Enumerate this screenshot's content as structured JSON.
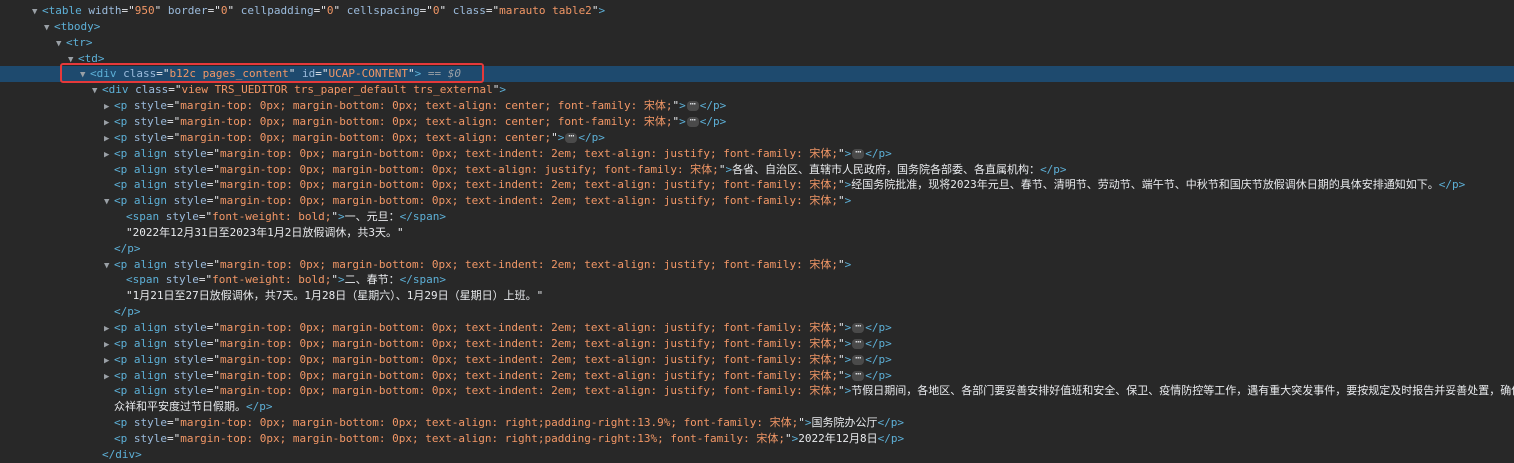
{
  "nodes": [
    {
      "indent": 0,
      "arrow": "expanded",
      "open": "<table",
      "attrs": [
        [
          "width",
          "950"
        ],
        [
          "border",
          "0"
        ],
        [
          "cellpadding",
          "0"
        ],
        [
          "cellspacing",
          "0"
        ],
        [
          "class",
          "marauto table2"
        ]
      ],
      "close": ">"
    },
    {
      "indent": 1,
      "arrow": "expanded",
      "open": "<tbody",
      "attrs": [],
      "close": ">"
    },
    {
      "indent": 2,
      "arrow": "expanded",
      "open": "<tr",
      "attrs": [],
      "close": ">"
    },
    {
      "indent": 3,
      "arrow": "expanded",
      "open": "<td",
      "attrs": [],
      "close": ">"
    },
    {
      "indent": 4,
      "arrow": "expanded",
      "open": "<div",
      "attrs": [
        [
          "class",
          "b12c pages_content"
        ],
        [
          "id",
          "UCAP-CONTENT"
        ]
      ],
      "close": ">",
      "suffix": " == $0",
      "selected": true
    },
    {
      "indent": 5,
      "arrow": "expanded",
      "open": "<div",
      "attrs": [
        [
          "class",
          "view TRS_UEDITOR trs_paper_default trs_external"
        ]
      ],
      "close": ">"
    },
    {
      "indent": 6,
      "arrow": "collapsed",
      "open": "<p",
      "attrs": [
        [
          "style",
          "margin-top: 0px; margin-bottom: 0px; text-align: center; font-family: 宋体;"
        ]
      ],
      "close": ">",
      "ellipsis": true,
      "end": "</p>"
    },
    {
      "indent": 6,
      "arrow": "collapsed",
      "open": "<p",
      "attrs": [
        [
          "style",
          "margin-top: 0px; margin-bottom: 0px; text-align: center; font-family: 宋体;"
        ]
      ],
      "close": ">",
      "ellipsis": true,
      "end": "</p>"
    },
    {
      "indent": 6,
      "arrow": "collapsed",
      "open": "<p",
      "attrs": [
        [
          "style",
          "margin-top: 0px; margin-bottom: 0px; text-align: center;"
        ]
      ],
      "close": ">",
      "ellipsis": true,
      "end": "</p>"
    },
    {
      "indent": 6,
      "arrow": "collapsed",
      "open": "<p align",
      "attrs": [
        [
          "style",
          "margin-top: 0px; margin-bottom: 0px; text-indent: 2em; text-align: justify; font-family: 宋体;"
        ]
      ],
      "close": ">",
      "ellipsis": true,
      "end": "</p>"
    },
    {
      "indent": 6,
      "arrow": "none",
      "open": "<p align",
      "attrs": [
        [
          "style",
          "margin-top: 0px; margin-bottom: 0px; text-align: justify; font-family: 宋体;"
        ]
      ],
      "close": ">",
      "text": "各省、自治区、直辖市人民政府，国务院各部委、各直属机构：",
      "end": "</p>"
    },
    {
      "indent": 6,
      "arrow": "none",
      "open": "<p align",
      "attrs": [
        [
          "style",
          "margin-top: 0px; margin-bottom: 0px; text-indent: 2em; text-align: justify; font-family: 宋体;"
        ]
      ],
      "close": ">",
      "text": "经国务院批准，现将2023年元旦、春节、清明节、劳动节、端午节、中秋节和国庆节放假调休日期的具体安排通知如下。",
      "end": "</p>"
    },
    {
      "indent": 6,
      "arrow": "expanded",
      "open": "<p align",
      "attrs": [
        [
          "style",
          "margin-top: 0px; margin-bottom: 0px; text-indent: 2em; text-align: justify; font-family: 宋体;"
        ]
      ],
      "close": ">"
    },
    {
      "indent": 7,
      "arrow": "none",
      "open": "<span",
      "attrs": [
        [
          "style",
          "font-weight: bold;"
        ]
      ],
      "close": ">",
      "text": "一、元旦：",
      "end": "</span>"
    },
    {
      "indent": 7,
      "arrow": "none",
      "plain": "\"2022年12月31日至2023年1月2日放假调休，共3天。\""
    },
    {
      "indent": 6,
      "arrow": "none",
      "endonly": "</p>"
    },
    {
      "indent": 6,
      "arrow": "expanded",
      "open": "<p align",
      "attrs": [
        [
          "style",
          "margin-top: 0px; margin-bottom: 0px; text-indent: 2em; text-align: justify; font-family: 宋体;"
        ]
      ],
      "close": ">"
    },
    {
      "indent": 7,
      "arrow": "none",
      "open": "<span",
      "attrs": [
        [
          "style",
          "font-weight: bold;"
        ]
      ],
      "close": ">",
      "text": "二、春节：",
      "end": "</span>"
    },
    {
      "indent": 7,
      "arrow": "none",
      "plain": "\"1月21日至27日放假调休，共7天。1月28日（星期六）、1月29日（星期日）上班。\""
    },
    {
      "indent": 6,
      "arrow": "none",
      "endonly": "</p>"
    },
    {
      "indent": 6,
      "arrow": "collapsed",
      "open": "<p align",
      "attrs": [
        [
          "style",
          "margin-top: 0px; margin-bottom: 0px; text-indent: 2em; text-align: justify; font-family: 宋体;"
        ]
      ],
      "close": ">",
      "ellipsis": true,
      "end": "</p>"
    },
    {
      "indent": 6,
      "arrow": "collapsed",
      "open": "<p align",
      "attrs": [
        [
          "style",
          "margin-top: 0px; margin-bottom: 0px; text-indent: 2em; text-align: justify; font-family: 宋体;"
        ]
      ],
      "close": ">",
      "ellipsis": true,
      "end": "</p>"
    },
    {
      "indent": 6,
      "arrow": "collapsed",
      "open": "<p align",
      "attrs": [
        [
          "style",
          "margin-top: 0px; margin-bottom: 0px; text-indent: 2em; text-align: justify; font-family: 宋体;"
        ]
      ],
      "close": ">",
      "ellipsis": true,
      "end": "</p>"
    },
    {
      "indent": 6,
      "arrow": "collapsed",
      "open": "<p align",
      "attrs": [
        [
          "style",
          "margin-top: 0px; margin-bottom: 0px; text-indent: 2em; text-align: justify; font-family: 宋体;"
        ]
      ],
      "close": ">",
      "ellipsis": true,
      "end": "</p>"
    },
    {
      "indent": 6,
      "arrow": "none",
      "open": "<p align",
      "attrs": [
        [
          "style",
          "margin-top: 0px; margin-bottom: 0px; text-indent: 2em; text-align: justify; font-family: 宋体;"
        ]
      ],
      "close": ">",
      "text": "节假日期间，各地区、各部门要妥善安排好值班和安全、保卫、疫情防控等工作，遇有重大突发事件，要按规定及时报告并妥善处置，确保"
    },
    {
      "indent": 6,
      "arrow": "none",
      "plain": "众祥和平安度过节日假期。",
      "end": "</p>"
    },
    {
      "indent": 6,
      "arrow": "none",
      "open": "<p",
      "attrs": [
        [
          "style",
          "margin-top: 0px; margin-bottom: 0px; text-align: right;padding-right:13.9%; font-family: 宋体;"
        ]
      ],
      "close": ">",
      "text": "国务院办公厅",
      "end": "</p>"
    },
    {
      "indent": 6,
      "arrow": "none",
      "open": "<p",
      "attrs": [
        [
          "style",
          "margin-top: 0px; margin-bottom: 0px; text-align: right;padding-right:13%; font-family: 宋体;"
        ]
      ],
      "close": ">",
      "text": "2022年12月8日",
      "end": "</p>"
    },
    {
      "indent": 5,
      "arrow": "none",
      "endonly": "</div>"
    }
  ],
  "colors": {
    "background": "#282828",
    "selected_row": "#1e4a6e",
    "highlight_border": "#e5393a",
    "tag": "#5db0d7",
    "attr_name": "#9bbbdc",
    "attr_value": "#f29766"
  }
}
